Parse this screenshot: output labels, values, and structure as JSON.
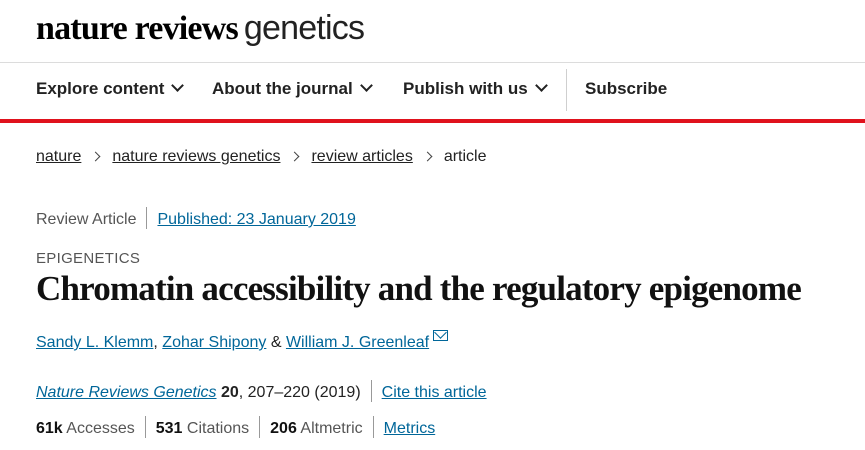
{
  "header": {
    "logo_bold": "nature reviews",
    "logo_light": "genetics",
    "nav": [
      {
        "label": "Explore content",
        "dropdown": true
      },
      {
        "label": "About the journal",
        "dropdown": true
      },
      {
        "label": "Publish with us",
        "dropdown": true
      },
      {
        "label": "Subscribe",
        "dropdown": false
      }
    ],
    "accent_color": "#e0121d"
  },
  "breadcrumb": [
    "nature",
    "nature reviews genetics",
    "review articles",
    "article"
  ],
  "article": {
    "type": "Review Article",
    "published": "Published: 23 January 2019",
    "subject": "EPIGENETICS",
    "title": "Chromatin accessibility and the regulatory epigenome",
    "authors": [
      "Sandy L. Klemm",
      "Zohar Shipony",
      "William J. Greenleaf"
    ],
    "author_sep_comma": ",",
    "author_sep_and": "&",
    "journal": "Nature Reviews Genetics",
    "volume": "20",
    "pages_year": ", 207–220 (2019)",
    "cite": "Cite this article",
    "metrics": {
      "accesses_value": "61k",
      "accesses_label": "Accesses",
      "citations_value": "531",
      "citations_label": "Citations",
      "altmetric_value": "206",
      "altmetric_label": "Altmetric",
      "metrics_link": "Metrics"
    },
    "link_color": "#006699"
  }
}
